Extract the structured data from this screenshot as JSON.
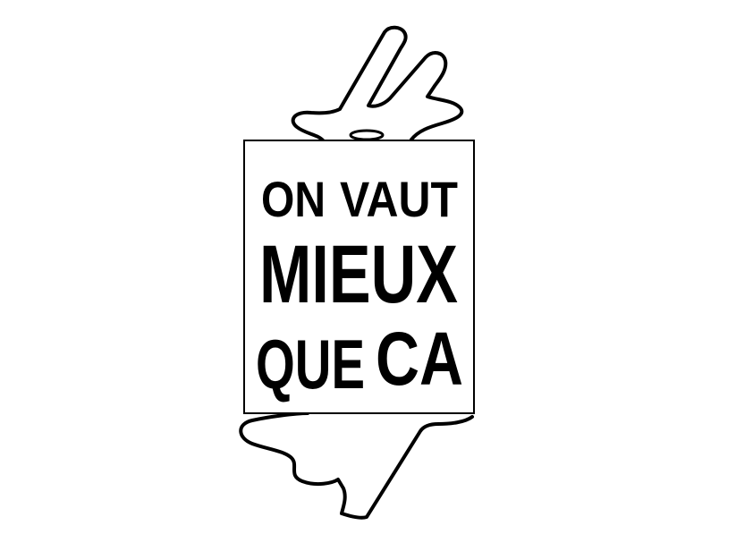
{
  "logo": {
    "lines": [
      {
        "words": [
          "ON",
          "VAUT"
        ]
      },
      {
        "words": [
          "MIEUX"
        ]
      },
      {
        "words": [
          "QUE",
          "CA"
        ]
      }
    ]
  },
  "colors": {
    "background": "#ffffff",
    "ink": "#000000"
  }
}
